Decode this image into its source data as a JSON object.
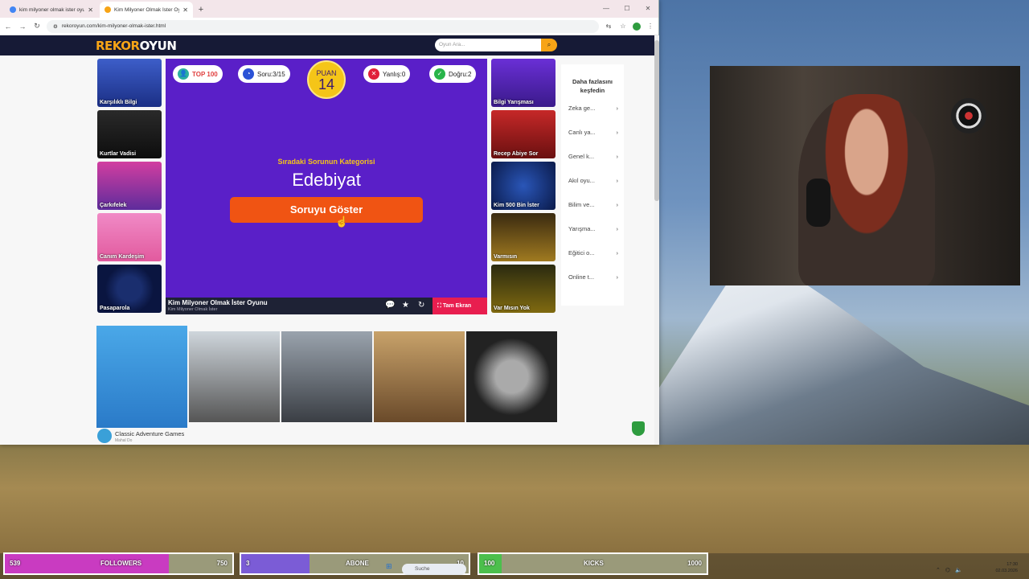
{
  "browser": {
    "tabs": [
      {
        "title": "kim milyoner olmak ister oyunu",
        "active": false
      },
      {
        "title": "Kim Milyoner Olmak İster Oyun",
        "active": true
      }
    ],
    "url": "rekoroyun.com/kim-milyoner-olmak-ister.html"
  },
  "site": {
    "logo_main": "REKOR",
    "logo_accent": "OYUN",
    "search_placeholder": "Oyun Ara...",
    "left_games": [
      "Karşılıklı Bilgi",
      "Kurtlar Vadisi",
      "Çarkıfelek",
      "Canım Kardeşim",
      "Pasaparola"
    ],
    "right_games": [
      "Bilgi Yarışması",
      "Recep Abiye Sor",
      "Kim 500 Bin İster",
      "Varmısın",
      "Var Mısın Yok"
    ],
    "game": {
      "top_label": "TOP 100",
      "question_label": "Soru:3/15",
      "points_label": "PUAN",
      "points_value": "14",
      "wrong_label": "Yanlış:0",
      "correct_label": "Doğru:2",
      "category_caption": "Sıradaki Sorunun Kategorisi",
      "category": "Edebiyat",
      "show_button": "Soruyu Göster",
      "footer_title": "Kim Milyoner Olmak İster Oyunu",
      "footer_subtitle": "Kim Milyoner Olmak İster",
      "fullscreen": "Tam Ekran"
    },
    "discover": {
      "heading": "Daha fazlasını keşfedin",
      "items": [
        "Zeka ge...",
        "Canlı ya...",
        "Genel k...",
        "Akıl oyu...",
        "Bilim ve...",
        "Yarışma...",
        "Eğitici o...",
        "Online t..."
      ]
    },
    "ad": {
      "caption": "Classic Adventure Games",
      "subcaption": "Mahal Do"
    }
  },
  "overlay": {
    "followers": {
      "current": "539",
      "label": "FOLLOWERS",
      "goal": "750",
      "color": "#c93bc1",
      "progress": 0.72
    },
    "abone": {
      "current": "3",
      "label": "ABONE",
      "goal": "10",
      "color": "#7b5cd6",
      "progress": 0.3
    },
    "kicks": {
      "current": "100",
      "label": "KICKS",
      "goal": "1000",
      "color": "#4cbf4c",
      "progress": 0.1
    }
  },
  "taskbar": {
    "search": "Suche",
    "time": "17:30",
    "date": "02.03.2026"
  }
}
